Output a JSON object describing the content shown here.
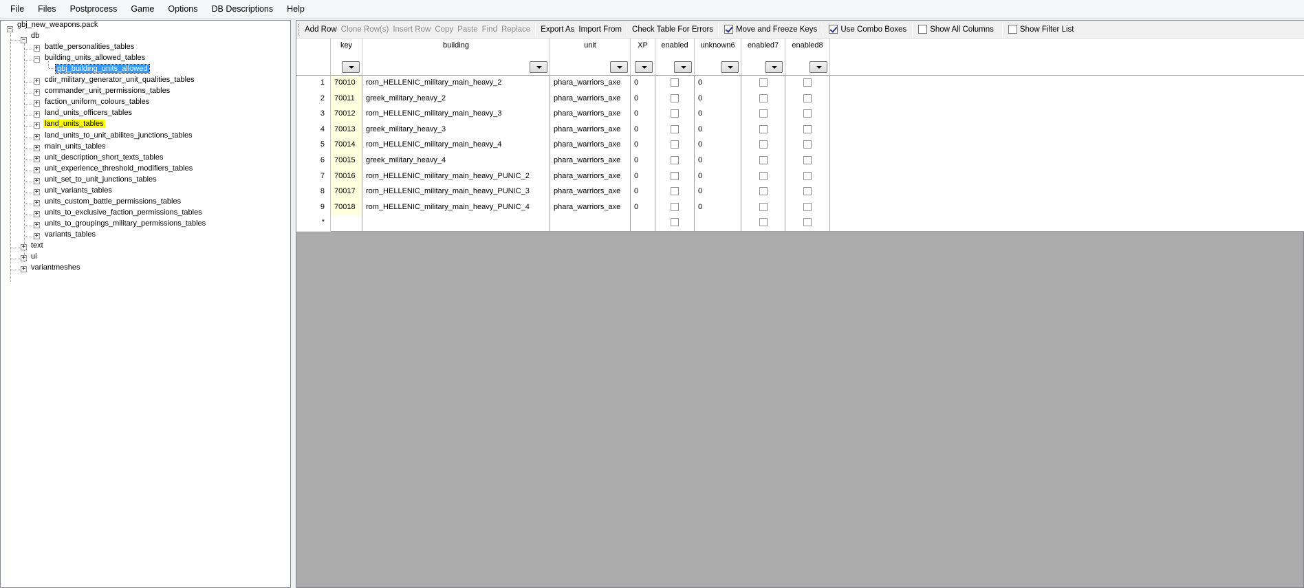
{
  "menu": [
    "File",
    "Files",
    "Postprocess",
    "Game",
    "Options",
    "DB Descriptions",
    "Help"
  ],
  "tree": {
    "root": "gbj_new_weapons.pack",
    "db": "db",
    "db_children": [
      "battle_personalities_tables",
      "building_units_allowed_tables",
      "gbj_building_units_allowed",
      "cdir_military_generator_unit_qualities_tables",
      "commander_unit_permissions_tables",
      "faction_uniform_colours_tables",
      "land_units_officers_tables",
      "land_units_tables",
      "land_units_to_unit_abilites_junctions_tables",
      "main_units_tables",
      "unit_description_short_texts_tables",
      "unit_experience_threshold_modifiers_tables",
      "unit_set_to_unit_junctions_tables",
      "unit_variants_tables",
      "units_custom_battle_permissions_tables",
      "units_to_exclusive_faction_permissions_tables",
      "units_to_groupings_military_permissions_tables",
      "variants_tables"
    ],
    "top_others": [
      "text",
      "ui",
      "variantmeshes"
    ],
    "selected": "gbj_building_units_allowed",
    "highlighted": "land_units_tables"
  },
  "toolbar": {
    "add_row": "Add Row",
    "clone_rows": "Clone Row(s)",
    "insert_row": "Insert Row",
    "copy": "Copy",
    "paste": "Paste",
    "find": "Find",
    "replace": "Replace",
    "export_as": "Export As",
    "import_from": "Import From",
    "check_errors": "Check Table For Errors",
    "move_freeze": "Move and Freeze Keys",
    "move_freeze_checked": true,
    "use_combo": "Use Combo Boxes",
    "use_combo_checked": true,
    "show_all_columns": "Show All Columns",
    "show_all_columns_checked": false,
    "show_filter_list": "Show Filter List",
    "show_filter_list_checked": false
  },
  "table": {
    "columns": [
      "key",
      "building",
      "unit",
      "XP",
      "enabled",
      "unknown6",
      "enabled7",
      "enabled8"
    ],
    "new_row_marker": "*",
    "rows": [
      {
        "n": "1",
        "key": "70010",
        "building": "rom_HELLENIC_military_main_heavy_2",
        "unit": "phara_warriors_axe",
        "xp": "0",
        "enabled": false,
        "unknown6": "0",
        "enabled7": false,
        "enabled8": false
      },
      {
        "n": "2",
        "key": "70011",
        "building": "greek_military_heavy_2",
        "unit": "phara_warriors_axe",
        "xp": "0",
        "enabled": false,
        "unknown6": "0",
        "enabled7": false,
        "enabled8": false
      },
      {
        "n": "3",
        "key": "70012",
        "building": "rom_HELLENIC_military_main_heavy_3",
        "unit": "phara_warriors_axe",
        "xp": "0",
        "enabled": false,
        "unknown6": "0",
        "enabled7": false,
        "enabled8": false
      },
      {
        "n": "4",
        "key": "70013",
        "building": "greek_military_heavy_3",
        "unit": "phara_warriors_axe",
        "xp": "0",
        "enabled": false,
        "unknown6": "0",
        "enabled7": false,
        "enabled8": false
      },
      {
        "n": "5",
        "key": "70014",
        "building": "rom_HELLENIC_military_main_heavy_4",
        "unit": "phara_warriors_axe",
        "xp": "0",
        "enabled": false,
        "unknown6": "0",
        "enabled7": false,
        "enabled8": false
      },
      {
        "n": "6",
        "key": "70015",
        "building": "greek_military_heavy_4",
        "unit": "phara_warriors_axe",
        "xp": "0",
        "enabled": false,
        "unknown6": "0",
        "enabled7": false,
        "enabled8": false
      },
      {
        "n": "7",
        "key": "70016",
        "building": "rom_HELLENIC_military_main_heavy_PUNIC_2",
        "unit": "phara_warriors_axe",
        "xp": "0",
        "enabled": false,
        "unknown6": "0",
        "enabled7": false,
        "enabled8": false
      },
      {
        "n": "8",
        "key": "70017",
        "building": "rom_HELLENIC_military_main_heavy_PUNIC_3",
        "unit": "phara_warriors_axe",
        "xp": "0",
        "enabled": false,
        "unknown6": "0",
        "enabled7": false,
        "enabled8": false
      },
      {
        "n": "9",
        "key": "70018",
        "building": "rom_HELLENIC_military_main_heavy_PUNIC_4",
        "unit": "phara_warriors_axe",
        "xp": "0",
        "enabled": false,
        "unknown6": "0",
        "enabled7": false,
        "enabled8": false
      }
    ]
  },
  "colors": {
    "selection": "#3399ff",
    "highlight": "#ffff00",
    "key_cell": "#ffffe0",
    "empty_area": "#ababab"
  }
}
